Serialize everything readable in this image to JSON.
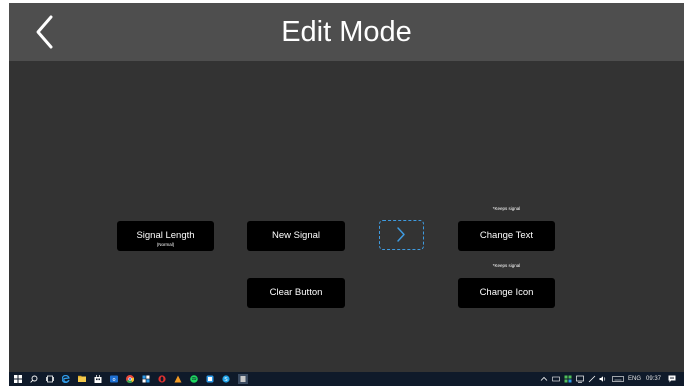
{
  "header": {
    "title": "Edit Mode"
  },
  "buttons": {
    "signal_length": {
      "label": "Signal Length",
      "sub": "(Normal)"
    },
    "new_signal": {
      "label": "New Signal"
    },
    "change_text": {
      "label": "Change Text",
      "note": "*Keeps signal"
    },
    "clear_button": {
      "label": "Clear Button"
    },
    "change_icon": {
      "label": "Change Icon",
      "note": "*Keeps signal"
    }
  },
  "taskbar": {
    "language": "ENG",
    "time": "09:37"
  },
  "colors": {
    "background": "#333333",
    "header": "#4e4e4e",
    "button": "#000000",
    "accent_dashed": "#3f9be0",
    "taskbar": "#0f1a2a"
  }
}
